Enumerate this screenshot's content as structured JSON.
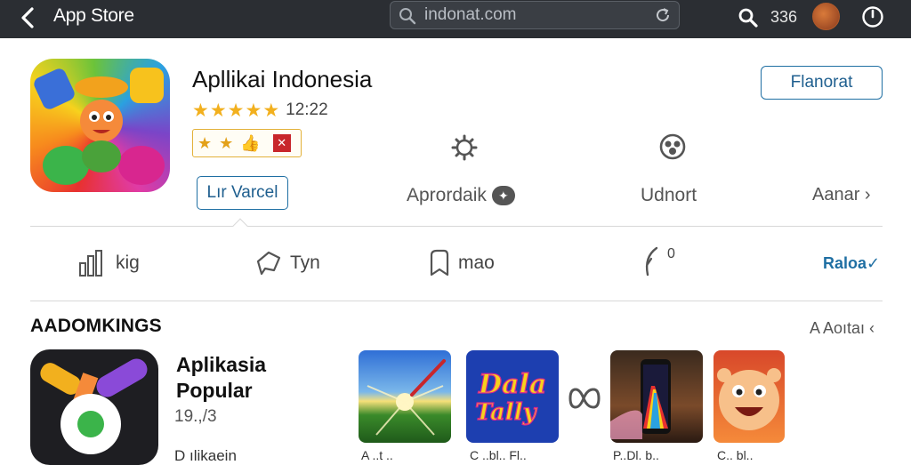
{
  "topbar": {
    "title": "App Store",
    "url_value": "indonat.com",
    "count": "336"
  },
  "app": {
    "name": "Apllikai Indonesia",
    "rating_time": "12:22",
    "primary_button": "Flanorat",
    "secondary_button": "Lır Varcel",
    "meta": [
      {
        "label": "Aprordaik",
        "icon": "gear-icon"
      },
      {
        "label": "Udnort",
        "icon": "location-icon"
      },
      {
        "label": "Aanar ›",
        "icon": "none"
      }
    ]
  },
  "tabs": [
    {
      "label": "kig",
      "icon": "bar-chart-icon"
    },
    {
      "label": "Tyn",
      "icon": "share-icon"
    },
    {
      "label": "mao",
      "icon": "bookmark-icon"
    },
    {
      "label": "",
      "icon": "leaf-icon",
      "superscript": "0"
    }
  ],
  "tabs_more": "Raloa✓",
  "section": {
    "title": "AADOMKINGS",
    "more": "A Aoıtaı ‹",
    "featured": {
      "title": "Aplikasia Popular",
      "meta": "19.,/3",
      "sub": "D ılikaein"
    },
    "thumbs": [
      {
        "label": "A ..t ..",
        "icon": "sunburst-icon"
      },
      {
        "label": "C ..bl.. Fl..",
        "icon": "dala-logo-icon",
        "text": "Dala Tally"
      },
      {
        "label": "P..Dl. b..",
        "icon": "phone-rainbow-icon"
      },
      {
        "label": "C.. bl..",
        "icon": "smiley-icon"
      }
    ]
  },
  "colors": {
    "topbar_bg": "#2b2e33",
    "accent_blue": "#1f6fa3",
    "star_gold": "#f2b01e"
  }
}
